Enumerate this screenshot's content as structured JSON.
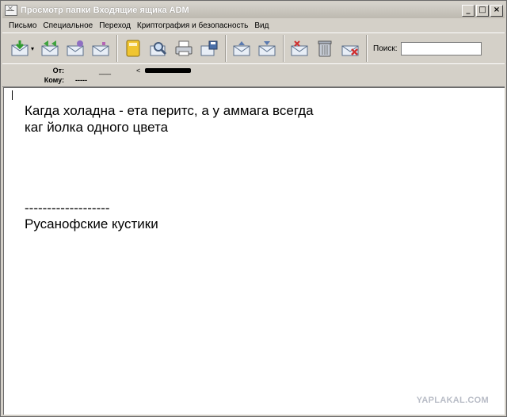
{
  "window": {
    "title": "Просмотр папки Входящие ящика ADM",
    "controls": {
      "minimize": "_",
      "maximize": "□",
      "close": "×"
    }
  },
  "menu": {
    "items": [
      "Письмо",
      "Специальное",
      "Переход",
      "Криптография и безопасность",
      "Вид"
    ]
  },
  "toolbar": {
    "icons": [
      "receive-mail-icon",
      "forward-icon",
      "reply-icon",
      "reply-all-icon",
      "address-book-icon",
      "find-icon",
      "print-icon",
      "save-icon",
      "move-up-icon",
      "move-down-icon",
      "delete-mark-icon",
      "trash-icon",
      "delete-icon"
    ],
    "dropdown_arrow": "▾",
    "search_label": "Поиск:",
    "search_value": ""
  },
  "headers": {
    "from_label": "От:",
    "from_value": "___",
    "from_address_prefix": "<",
    "to_label": "Кому:",
    "to_value": "-----"
  },
  "message": {
    "lines": [
      "Кагда холадна - ета перитс, а у аммага всегда",
      "каг йолка одного цвета",
      "-------------------",
      "Русанофские кустики"
    ]
  },
  "watermark": "YAPLAKAL.COM"
}
